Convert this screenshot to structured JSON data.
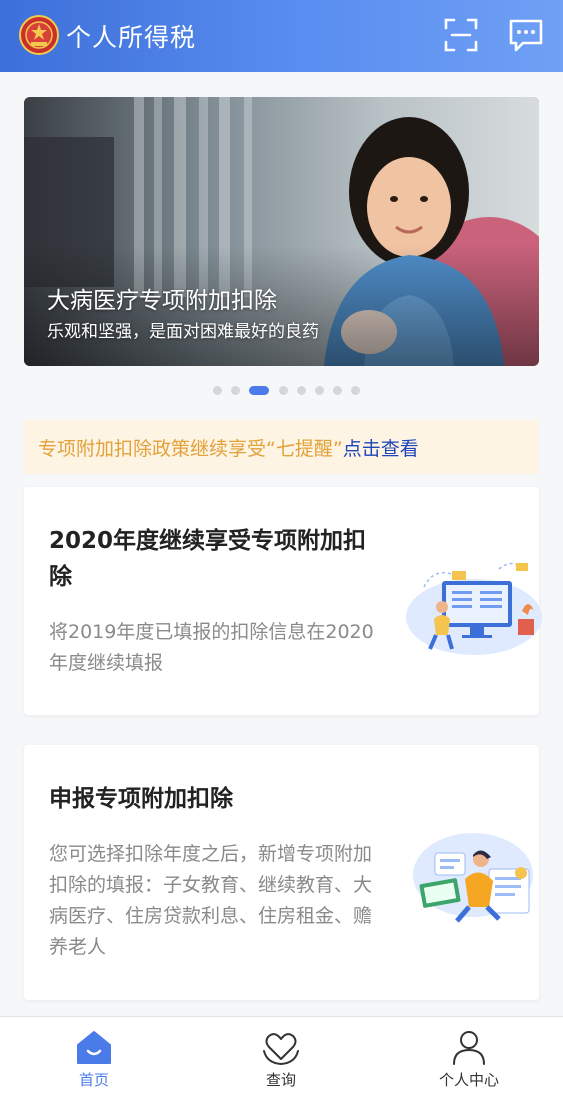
{
  "header": {
    "title": "个人所得税",
    "icons": [
      "emblem-icon",
      "scan-icon",
      "message-icon"
    ]
  },
  "banner": {
    "title": "大病医疗专项附加扣除",
    "subtitle": "乐观和坚强，是面对困难最好的良药",
    "page_count": 8,
    "active_page": 3
  },
  "notice": {
    "text": "专项附加扣除政策继续享受“七提醒”",
    "link": "点击查看"
  },
  "cards": [
    {
      "title": "2020年度继续享受专项附加扣除",
      "description": "将2019年度已填报的扣除信息在2020年度继续填报"
    },
    {
      "title": "申报专项附加扣除",
      "description": "您可选择扣除年度之后，新增专项附加扣除的填报：子女教育、继续教育、大病医疗、住房贷款利息、住房租金、赡养老人"
    }
  ],
  "bottom_nav": {
    "items": [
      {
        "label": "首页",
        "icon": "home-icon",
        "active": true
      },
      {
        "label": "查询",
        "icon": "heart-hands-icon",
        "active": false
      },
      {
        "label": "个人中心",
        "icon": "user-icon",
        "active": false
      }
    ]
  },
  "colors": {
    "header_start": "#3d6fd9",
    "header_end": "#6fa0f5",
    "accent": "#4a7be8",
    "notice_bg": "#fdf4e3",
    "notice_text": "#e3a13a",
    "notice_link": "#1f46b8"
  }
}
